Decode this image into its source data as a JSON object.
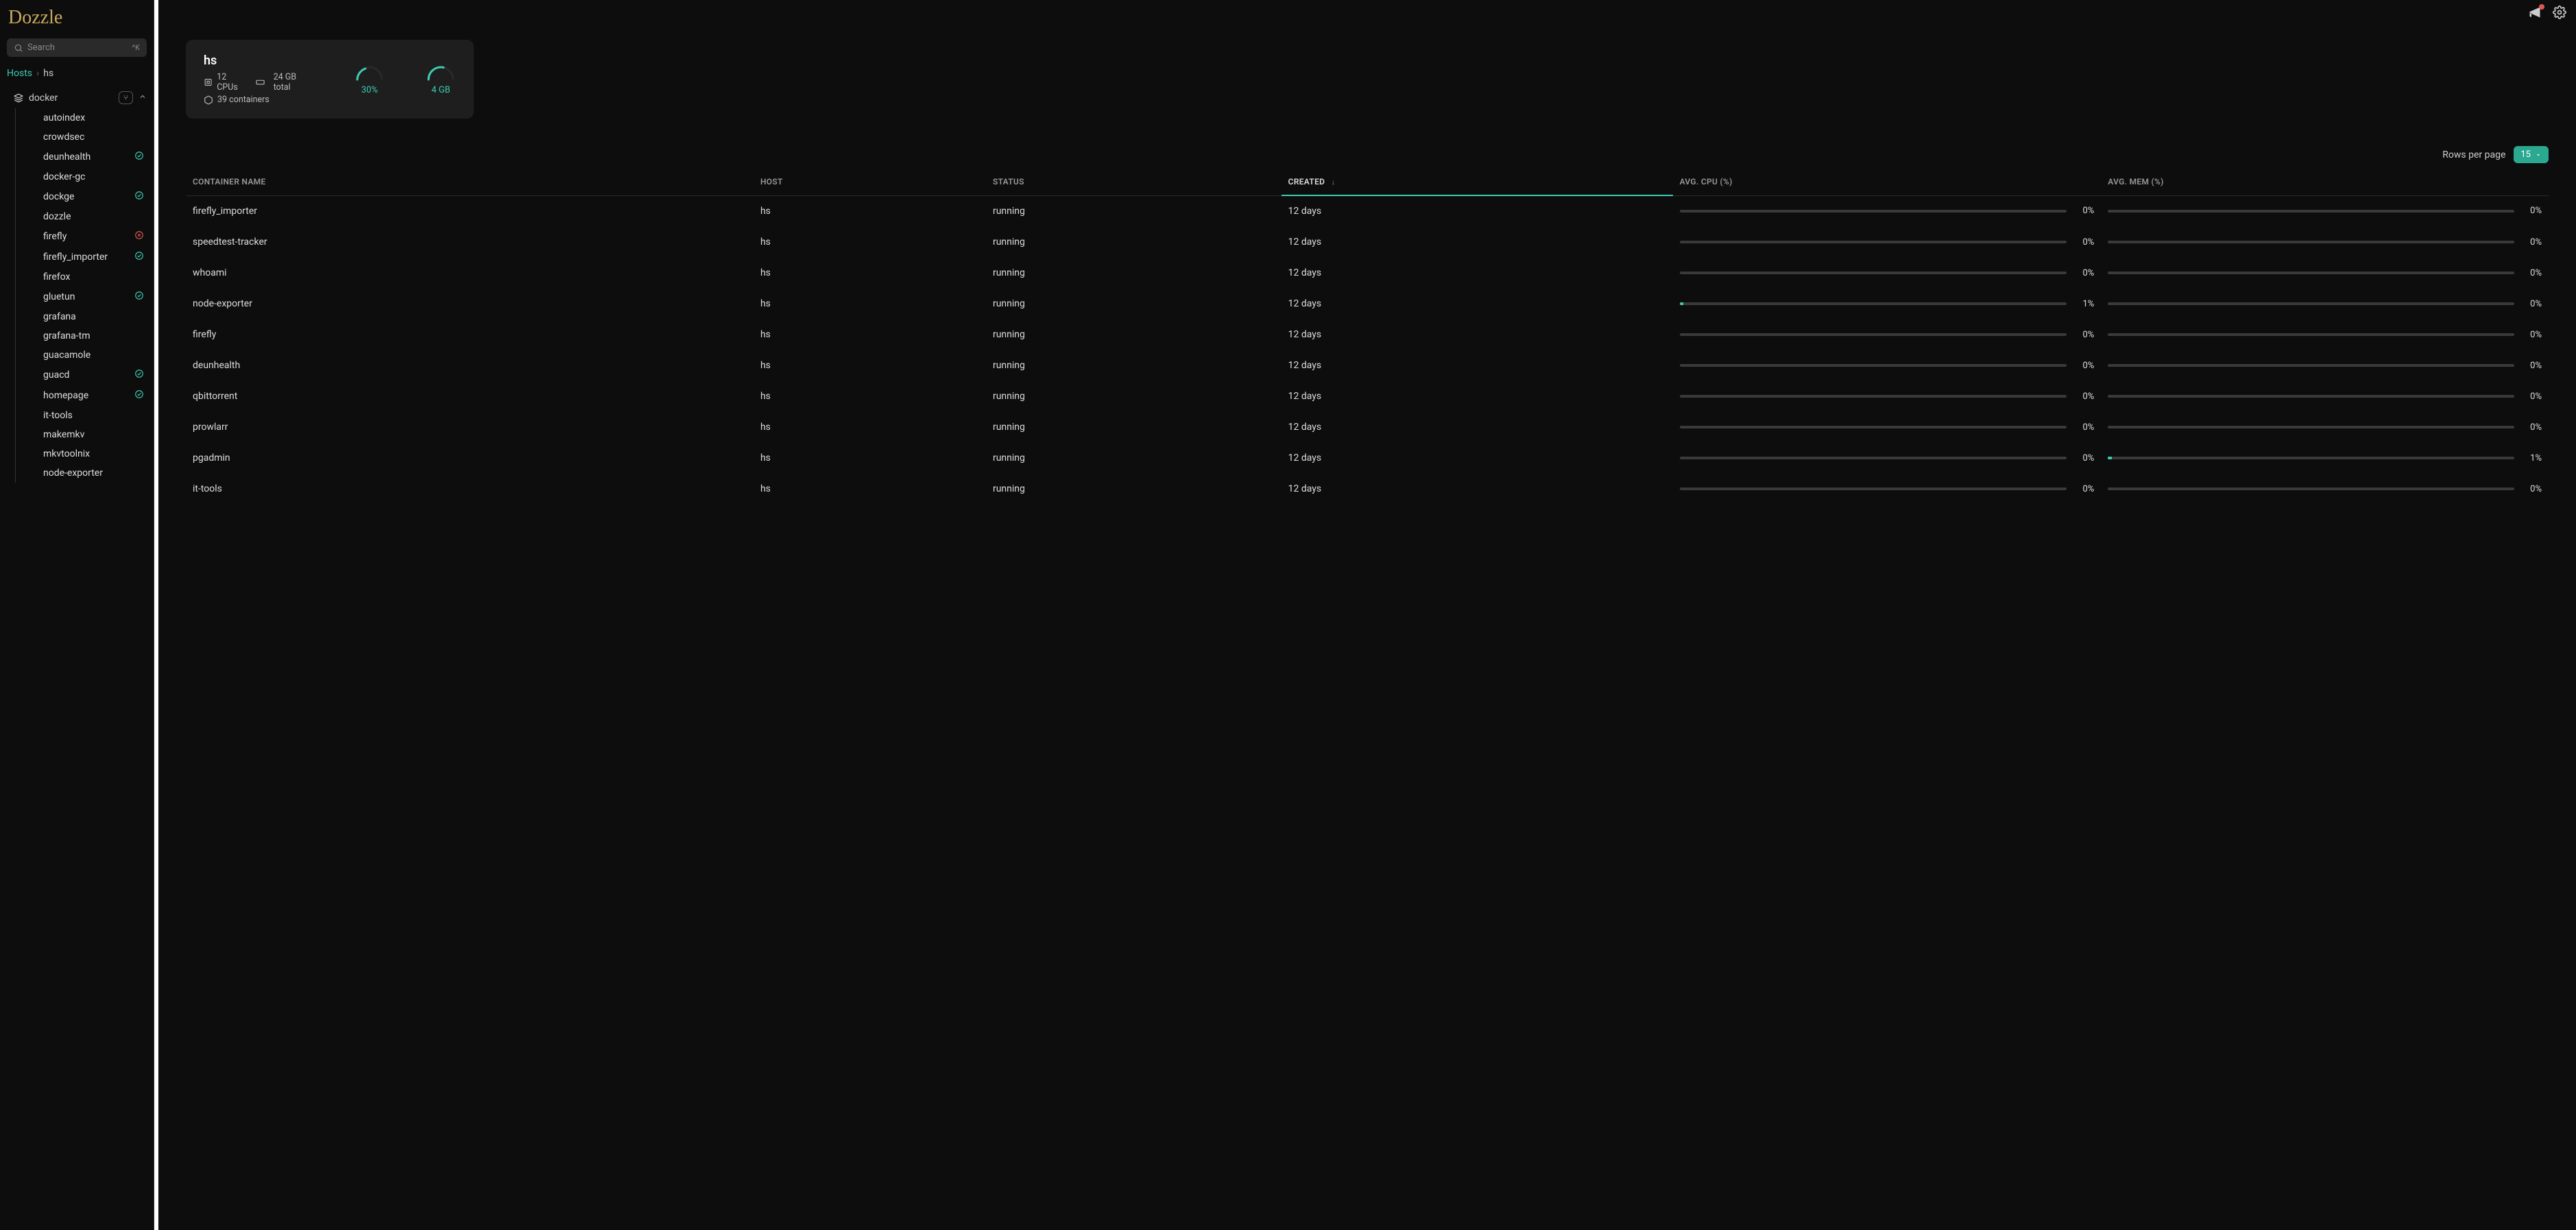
{
  "app": {
    "name": "Dozzle"
  },
  "search": {
    "placeholder": "Search",
    "shortcut": "^K"
  },
  "breadcrumb": {
    "root": "Hosts",
    "current": "hs"
  },
  "group": {
    "name": "docker",
    "merge_badge": "⑂"
  },
  "sidebar_items": [
    {
      "name": "autoindex",
      "status": null
    },
    {
      "name": "crowdsec",
      "status": null
    },
    {
      "name": "deunhealth",
      "status": "ok"
    },
    {
      "name": "docker-gc",
      "status": null
    },
    {
      "name": "dockge",
      "status": "ok"
    },
    {
      "name": "dozzle",
      "status": null
    },
    {
      "name": "firefly",
      "status": "err"
    },
    {
      "name": "firefly_importer",
      "status": "ok"
    },
    {
      "name": "firefox",
      "status": null
    },
    {
      "name": "gluetun",
      "status": "ok"
    },
    {
      "name": "grafana",
      "status": null
    },
    {
      "name": "grafana-tm",
      "status": null
    },
    {
      "name": "guacamole",
      "status": null
    },
    {
      "name": "guacd",
      "status": "ok"
    },
    {
      "name": "homepage",
      "status": "ok"
    },
    {
      "name": "it-tools",
      "status": null
    },
    {
      "name": "makemkv",
      "status": null
    },
    {
      "name": "mkvtoolnix",
      "status": null
    },
    {
      "name": "node-exporter",
      "status": null
    }
  ],
  "host": {
    "name": "hs",
    "cpus": "12 CPUs",
    "mem_total": "24 GB total",
    "containers": "39 containers",
    "cpu_gauge": "30%",
    "mem_gauge": "4 GB"
  },
  "table": {
    "rows_per_page_label": "Rows per page",
    "rows_per_page_value": "15",
    "columns": {
      "name": "CONTAINER NAME",
      "host": "HOST",
      "status": "STATUS",
      "created": "CREATED",
      "cpu": "AVG. CPU (%)",
      "mem": "AVG. MEM (%)"
    },
    "rows": [
      {
        "name": "firefly_importer",
        "host": "hs",
        "status": "running",
        "created": "12 days",
        "cpu": 0,
        "mem": 0
      },
      {
        "name": "speedtest-tracker",
        "host": "hs",
        "status": "running",
        "created": "12 days",
        "cpu": 0,
        "mem": 0
      },
      {
        "name": "whoami",
        "host": "hs",
        "status": "running",
        "created": "12 days",
        "cpu": 0,
        "mem": 0
      },
      {
        "name": "node-exporter",
        "host": "hs",
        "status": "running",
        "created": "12 days",
        "cpu": 1,
        "mem": 0
      },
      {
        "name": "firefly",
        "host": "hs",
        "status": "running",
        "created": "12 days",
        "cpu": 0,
        "mem": 0
      },
      {
        "name": "deunhealth",
        "host": "hs",
        "status": "running",
        "created": "12 days",
        "cpu": 0,
        "mem": 0
      },
      {
        "name": "qbittorrent",
        "host": "hs",
        "status": "running",
        "created": "12 days",
        "cpu": 0,
        "mem": 0
      },
      {
        "name": "prowlarr",
        "host": "hs",
        "status": "running",
        "created": "12 days",
        "cpu": 0,
        "mem": 0
      },
      {
        "name": "pgadmin",
        "host": "hs",
        "status": "running",
        "created": "12 days",
        "cpu": 0,
        "mem": 1
      },
      {
        "name": "it-tools",
        "host": "hs",
        "status": "running",
        "created": "12 days",
        "cpu": 0,
        "mem": 0
      }
    ]
  }
}
